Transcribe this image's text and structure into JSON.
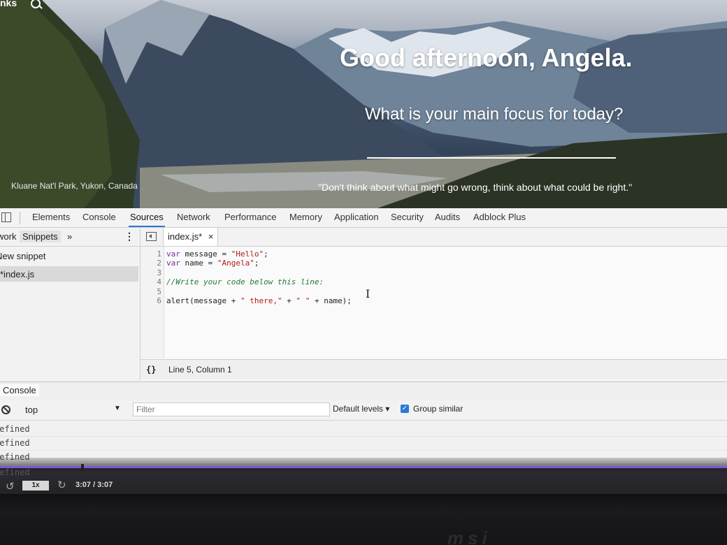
{
  "hero": {
    "links_label": "nks",
    "greeting": "Good afternoon, Angela.",
    "focus_question": "What is your main focus for today?",
    "photo_location": "Kluane Nat'l Park, Yukon, Canada",
    "quote": "\"Don't think about what might go wrong, think about what could be right.\""
  },
  "devtools": {
    "tabs": [
      "Elements",
      "Console",
      "Sources",
      "Network",
      "Performance",
      "Memory",
      "Application",
      "Security",
      "Audits",
      "Adblock Plus"
    ],
    "active_tab": "Sources",
    "navigator": {
      "tabs": [
        "work",
        "Snippets"
      ],
      "more": "»",
      "menu": "⋮",
      "items": [
        "New snippet",
        "*index.js"
      ],
      "selected_item": "*index.js"
    },
    "editor": {
      "file_tab": "index.js*",
      "close": "×",
      "line_numbers": [
        "1",
        "2",
        "3",
        "4",
        "5",
        "6"
      ],
      "status_braces": "{}",
      "status_text": "Line 5, Column 1"
    },
    "console": {
      "drawer_tab": "Console",
      "context": "top",
      "filter_placeholder": "Filter",
      "levels": "Default levels ▾",
      "group_similar": "Group similar",
      "group_similar_checked": true,
      "lines": [
        "defined",
        "defined",
        "defined",
        "defined"
      ]
    }
  },
  "player": {
    "speed": "1x",
    "time": "3:07 / 3:07",
    "progress": 1.0
  },
  "colors": {
    "accent": "#2b79d6",
    "progress": "#7b5ad6",
    "string": "#b11a1a",
    "keyword": "#7a2aa0",
    "comment": "#227a35"
  }
}
